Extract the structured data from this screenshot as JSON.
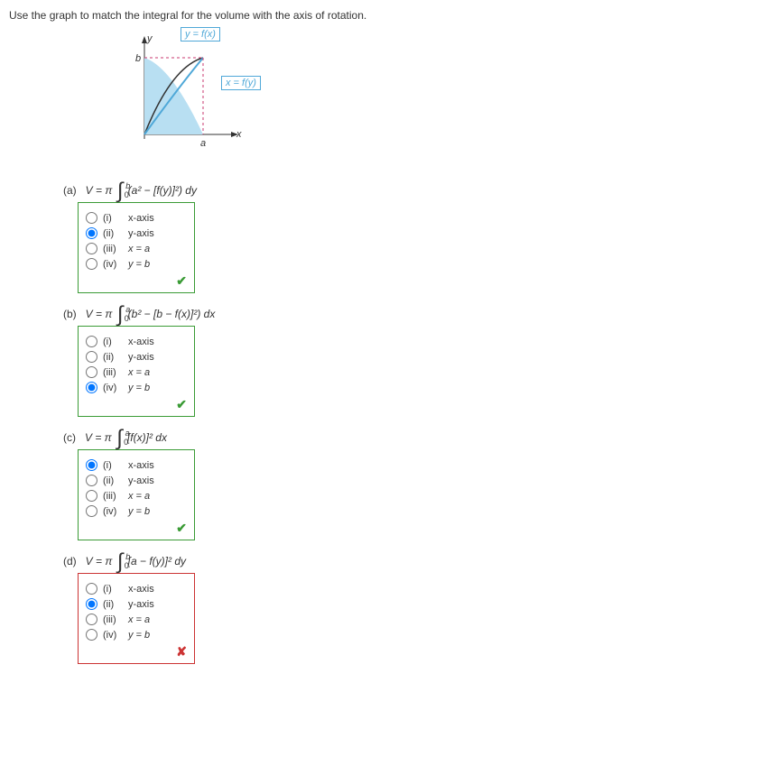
{
  "prompt": "Use the graph to match the integral for the volume with the axis of rotation.",
  "figure": {
    "y_label": "y",
    "b_label": "b",
    "x_label": "x",
    "a_label": "a",
    "curve_top": "y = f(x)",
    "curve_side": "x = f(y)"
  },
  "option_labels": {
    "i": "(i)",
    "ii": "(ii)",
    "iii": "(iii)",
    "iv": "(iv)",
    "i_val": "x-axis",
    "ii_val": "y-axis",
    "iii_val": "x = a",
    "iv_val": "y = b"
  },
  "problems": [
    {
      "label": "(a)",
      "prefix": "V = π",
      "upper": "b",
      "lower": "0",
      "body_html": "(a² − [f(y)]²) dy",
      "selected": "ii",
      "correct": true
    },
    {
      "label": "(b)",
      "prefix": "V = π",
      "upper": "a",
      "lower": "0",
      "body_html": "(b² − [b − f(x)]²) dx",
      "selected": "iv",
      "correct": true
    },
    {
      "label": "(c)",
      "prefix": "V = π",
      "upper": "a",
      "lower": "0",
      "body_html": "[f(x)]² dx",
      "selected": "i",
      "correct": true
    },
    {
      "label": "(d)",
      "prefix": "V = π",
      "upper": "b",
      "lower": "0",
      "body_html": "[a − f(y)]² dy",
      "selected": "ii",
      "correct": false
    }
  ],
  "feedback": {
    "correct_glyph": "✔",
    "incorrect_glyph": "✘"
  }
}
